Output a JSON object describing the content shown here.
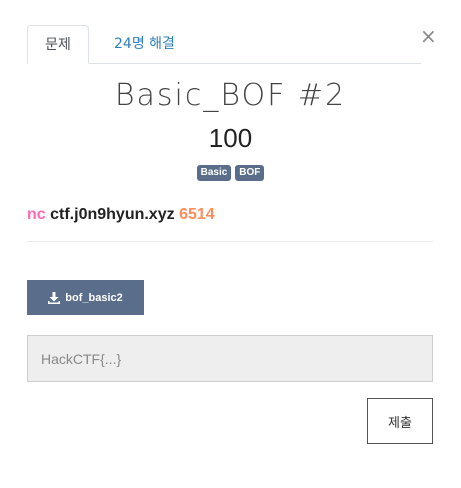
{
  "tabs": {
    "challenge_label": "문제",
    "solves_label": "24명 해결"
  },
  "close_label": "×",
  "challenge": {
    "name": "Basic_BOF #2",
    "value": "100",
    "tags": [
      "Basic",
      "BOF"
    ],
    "description": {
      "cmd": "nc",
      "host": "ctf.j0n9hyun.xyz",
      "port": "6514"
    },
    "file_label": "bof_basic2"
  },
  "submission": {
    "placeholder": "HackCTF{...}",
    "submit_label": "제출"
  },
  "colors": {
    "nc": "#ff69b4",
    "port": "#ff8c5a",
    "tag_bg": "#5a6e8c",
    "tab_link": "#2d7fbf"
  }
}
